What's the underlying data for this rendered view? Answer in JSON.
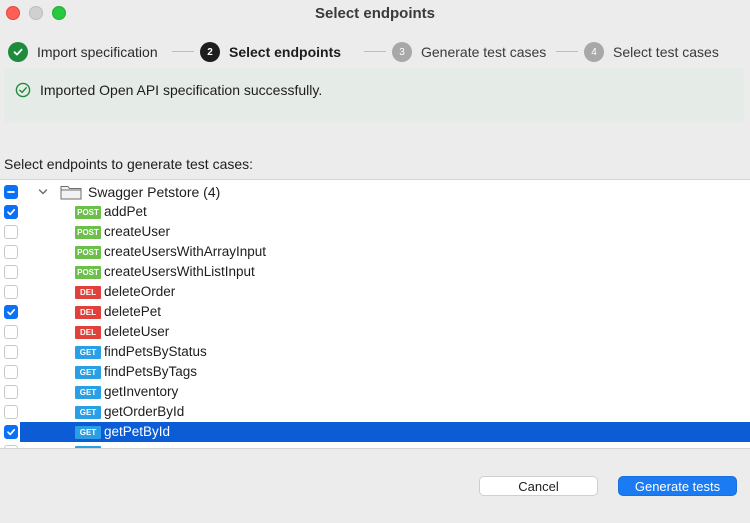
{
  "window": {
    "title": "Select endpoints"
  },
  "steps": [
    {
      "number": "1",
      "label": "Import specification",
      "state": "done"
    },
    {
      "number": "2",
      "label": "Select endpoints",
      "state": "active"
    },
    {
      "number": "3",
      "label": "Generate test cases",
      "state": "pending"
    },
    {
      "number": "4",
      "label": "Select test cases",
      "state": "pending"
    }
  ],
  "notice": {
    "text": "Imported Open API specification successfully.",
    "icon": "check-circle-icon",
    "color": "#1d8a3c"
  },
  "tree": {
    "label": "Select endpoints to generate test cases:",
    "group": {
      "name": "Swagger Petstore (4)",
      "state": "mixed",
      "icon": "folder-icon"
    },
    "endpoints": [
      {
        "method": "POST",
        "name": "addPet",
        "checked": true
      },
      {
        "method": "POST",
        "name": "createUser",
        "checked": false
      },
      {
        "method": "POST",
        "name": "createUsersWithArrayInput",
        "checked": false
      },
      {
        "method": "POST",
        "name": "createUsersWithListInput",
        "checked": false
      },
      {
        "method": "DEL",
        "name": "deleteOrder",
        "checked": false
      },
      {
        "method": "DEL",
        "name": "deletePet",
        "checked": true
      },
      {
        "method": "DEL",
        "name": "deleteUser",
        "checked": false
      },
      {
        "method": "GET",
        "name": "findPetsByStatus",
        "checked": false
      },
      {
        "method": "GET",
        "name": "findPetsByTags",
        "checked": false
      },
      {
        "method": "GET",
        "name": "getInventory",
        "checked": false
      },
      {
        "method": "GET",
        "name": "getOrderById",
        "checked": false
      },
      {
        "method": "GET",
        "name": "getPetById",
        "checked": true,
        "selected": true
      }
    ]
  },
  "buttons": {
    "cancel": "Cancel",
    "generate": "Generate tests"
  },
  "colors": {
    "accent": "#0a70f5",
    "selection": "#0b5cd5",
    "post": "#6cc04a",
    "delete": "#e0413a",
    "get": "#2b9fe6"
  }
}
